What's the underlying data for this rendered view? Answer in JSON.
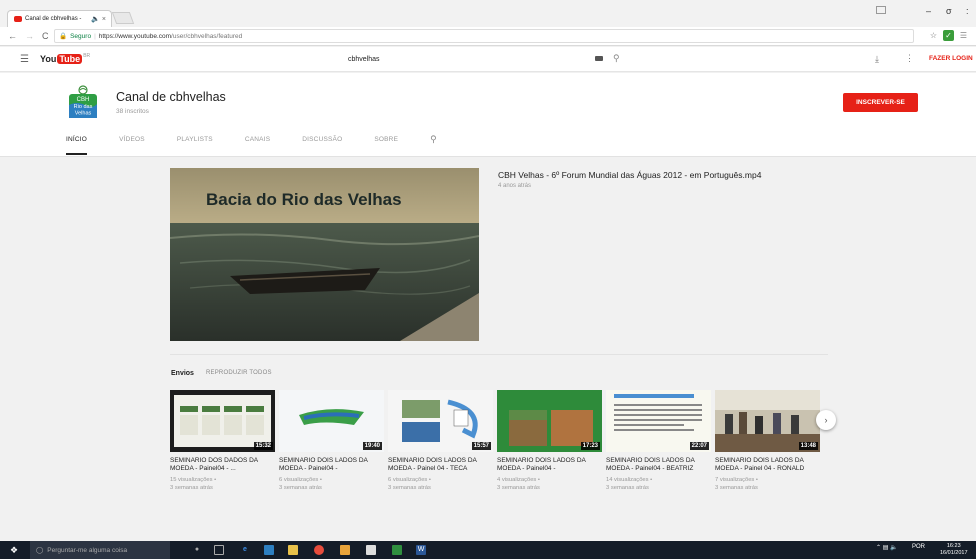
{
  "browser": {
    "tab_title": "Canal de cbhvelhas -",
    "tab_extra": "🔈 ×",
    "url_secure": "Seguro",
    "url_host": "https://www.youtube.com",
    "url_path": "/user/cbhvelhas/featured",
    "back": "←",
    "forward": "→",
    "reload": "C"
  },
  "youtube": {
    "logo_you": "You",
    "logo_tube": "Tube",
    "logo_region": "BR",
    "search_value": "cbhvelhas",
    "login_label": "FAZER LOGIN"
  },
  "channel": {
    "logo_text": [
      "CBH",
      "Rio das",
      "Velhas"
    ],
    "name": "Canal de cbhvelhas",
    "subscribers": "38 inscritos",
    "subscribe_label": "INSCREVER-SE",
    "tabs": [
      {
        "label": "INÍCIO",
        "active": true
      },
      {
        "label": "VÍDEOS",
        "active": false
      },
      {
        "label": "PLAYLISTS",
        "active": false
      },
      {
        "label": "CANAIS",
        "active": false
      },
      {
        "label": "DISCUSSÃO",
        "active": false
      },
      {
        "label": "SOBRE",
        "active": false
      }
    ]
  },
  "featured": {
    "thumb_caption": "Bacia do Rio das Velhas",
    "title": "CBH Velhas - 6º Forum Mundial das Águas 2012 - em Português.mp4",
    "age": "4 anos atrás"
  },
  "shelf": {
    "title": "Envios",
    "play_all": "REPRODUZIR TODOS",
    "videos": [
      {
        "title": "SEMINARIO DOS DADOS DA MOEDA - Painel04 - ...",
        "duration": "15:32",
        "views": "15 visualizações •",
        "age": "3 semanas atrás",
        "thumb_bg": "#1d1d1d"
      },
      {
        "title": "SEMINARIO DOIS LADOS DA MOEDA - Painel04 -",
        "duration": "19:40",
        "views": "6 visualizações •",
        "age": "3 semanas atrás",
        "thumb_bg": "#f4f6f8"
      },
      {
        "title": "SEMINARIO DOIS LADOS DA MOEDA - Painel 04 - TECA",
        "duration": "15:57",
        "views": "6 visualizações •",
        "age": "3 semanas atrás",
        "thumb_bg": "#2a2a2a"
      },
      {
        "title": "SEMINARIO DOIS LADOS DA MOEDA - Painel04 -",
        "duration": "17:23",
        "views": "4 visualizações •",
        "age": "3 semanas atrás",
        "thumb_bg": "#2e8b3a"
      },
      {
        "title": "SEMINARIO DOIS LADOS DA MOEDA - Painel04 - BEATRIZ",
        "duration": "22:07",
        "views": "14 visualizações •",
        "age": "3 semanas atrás",
        "thumb_bg": "#f8f8f0"
      },
      {
        "title": "SEMINARIO DOIS LADOS DA MOEDA - Painel 04 - RONALD",
        "duration": "13:48",
        "views": "7 visualizações •",
        "age": "3 semanas atrás",
        "thumb_bg": "#c9c2b0"
      }
    ],
    "next": "›"
  },
  "taskbar": {
    "search_placeholder": "Perguntar-me alguma coisa",
    "lang": "POR",
    "time": "16:23",
    "date": "16/01/2017"
  },
  "colors": {
    "brand_red": "#e62117",
    "secure_green": "#0b8043"
  }
}
